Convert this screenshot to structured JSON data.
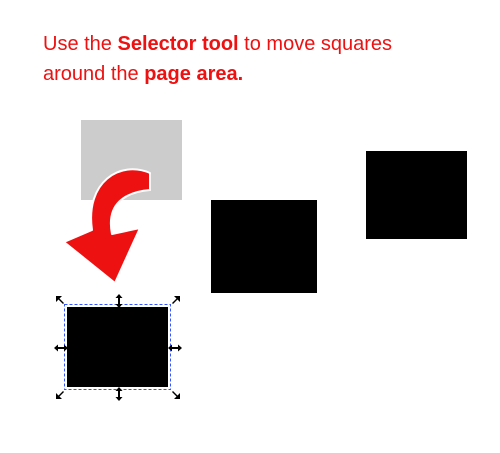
{
  "instructions": {
    "line1_prefix": "Use the ",
    "line1_bold": "Selector tool",
    "line1_suffix": " to move  squares",
    "line2_prefix": "around the ",
    "line2_bold": "page area."
  },
  "colors": {
    "text": "#ee1111",
    "arrow_fill": "#ee1111",
    "arrow_stroke": "#ffffff",
    "square": "#000000",
    "ghost_square": "#cccccc",
    "selection_dash": "#3355ff",
    "handle": "#000000"
  },
  "icons": {
    "arrow": "curved-arrow-icon",
    "handle_corner": "scale-handle-icon",
    "handle_side": "stretch-handle-icon"
  },
  "squares": [
    {
      "id": "ghost-original",
      "selected": false,
      "state": "original-position"
    },
    {
      "id": "square-middle",
      "selected": false,
      "state": "unselected"
    },
    {
      "id": "square-right",
      "selected": false,
      "state": "unselected"
    },
    {
      "id": "square-moved",
      "selected": true,
      "state": "selected"
    }
  ]
}
